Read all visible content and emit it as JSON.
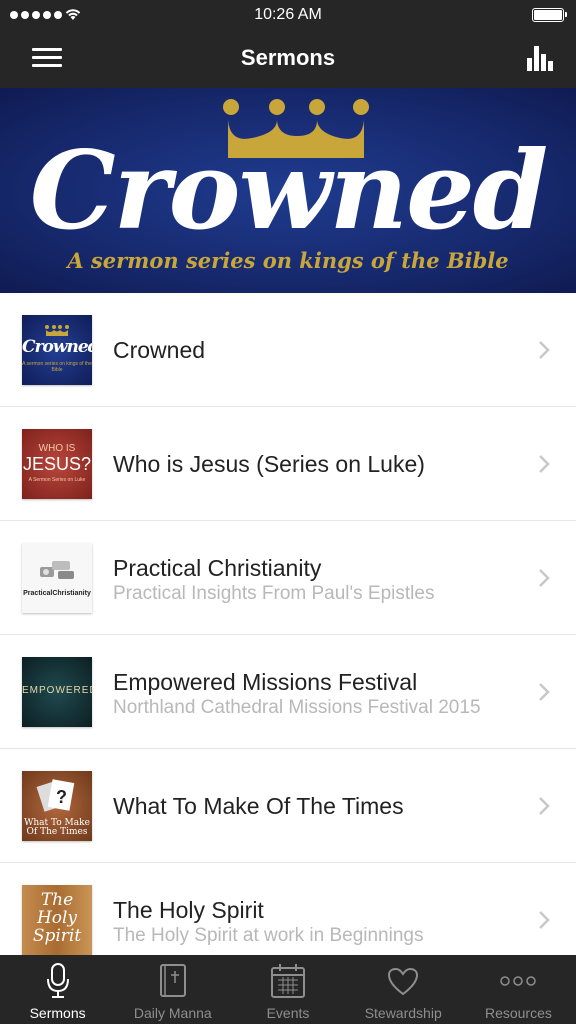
{
  "status_bar": {
    "time": "10:26 AM",
    "signal_icon": "signal-dots-icon",
    "wifi_icon": "wifi-icon",
    "battery_icon": "battery-icon"
  },
  "nav": {
    "title": "Sermons",
    "menu_icon": "hamburger-menu-icon",
    "stats_icon": "bar-chart-icon"
  },
  "banner": {
    "title": "Crowned",
    "subtitle": "A sermon series on kings of the Bible",
    "icon": "crown-icon",
    "colors": {
      "background": "#17296e",
      "gold": "#c9a639"
    }
  },
  "series": [
    {
      "title": "Crowned",
      "subtitle": "",
      "thumb": {
        "title": "Crowned",
        "subtitle": "A sermon series on kings of the Bible"
      }
    },
    {
      "title": "Who is Jesus (Series on Luke)",
      "subtitle": "",
      "thumb": {
        "title": "JESUS?",
        "pretitle": "WHO IS",
        "subtitle": "A Sermon Series on Luke"
      }
    },
    {
      "title": "Practical Christianity",
      "subtitle": "Practical Insights From Paul's Epistles",
      "thumb": {
        "title": "PracticalChristianity"
      }
    },
    {
      "title": "Empowered Missions Festival",
      "subtitle": "Northland Cathedral Missions Festival 2015",
      "thumb": {
        "title": "EMPOWERED"
      }
    },
    {
      "title": "What To Make Of The Times",
      "subtitle": "",
      "thumb": {
        "title": "What To Make Of The Times"
      }
    },
    {
      "title": "The Holy Spirit",
      "subtitle": "The Holy Spirit at work in Beginnings",
      "thumb": {
        "title": "The Holy Spirit"
      }
    }
  ],
  "tabs": [
    {
      "label": "Sermons",
      "icon": "microphone-icon",
      "active": true
    },
    {
      "label": "Daily Manna",
      "icon": "bible-icon",
      "active": false
    },
    {
      "label": "Events",
      "icon": "calendar-icon",
      "active": false
    },
    {
      "label": "Stewardship",
      "icon": "heart-icon",
      "active": false
    },
    {
      "label": "Resources",
      "icon": "more-dots-icon",
      "active": false
    }
  ]
}
